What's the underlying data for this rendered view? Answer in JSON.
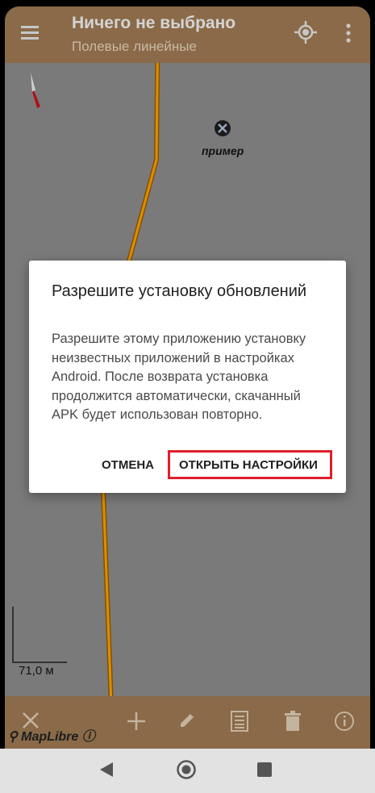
{
  "toolbar": {
    "title": "Ничего не выбрано",
    "subtitle": "Полевые линейные",
    "icons": [
      "menu-icon",
      "locate-icon",
      "more-vert-icon"
    ]
  },
  "map": {
    "marker_label": "пример",
    "scale_label": "71,0 м",
    "attribution": "MapLibre"
  },
  "bottom_toolbar": {
    "icons": [
      "close-icon",
      "add-icon",
      "edit-icon",
      "list-icon",
      "delete-icon",
      "info-icon"
    ]
  },
  "dialog": {
    "title": "Разрешите установку обновлений",
    "message": "Разрешите этому приложению установку неизвестных приложений в настройках Android. После возврата установка продолжится автоматически, скачанный APK будет использован повторно.",
    "cancel_label": "ОТМЕНА",
    "confirm_label": "ОТКРЫТЬ НАСТРОЙКИ"
  },
  "navbar": {
    "icons": [
      "back-icon",
      "home-icon",
      "recents-icon"
    ]
  },
  "colors": {
    "toolbar": "#8a6a48",
    "highlight": "#e01e2a",
    "route": "#c77d00"
  }
}
